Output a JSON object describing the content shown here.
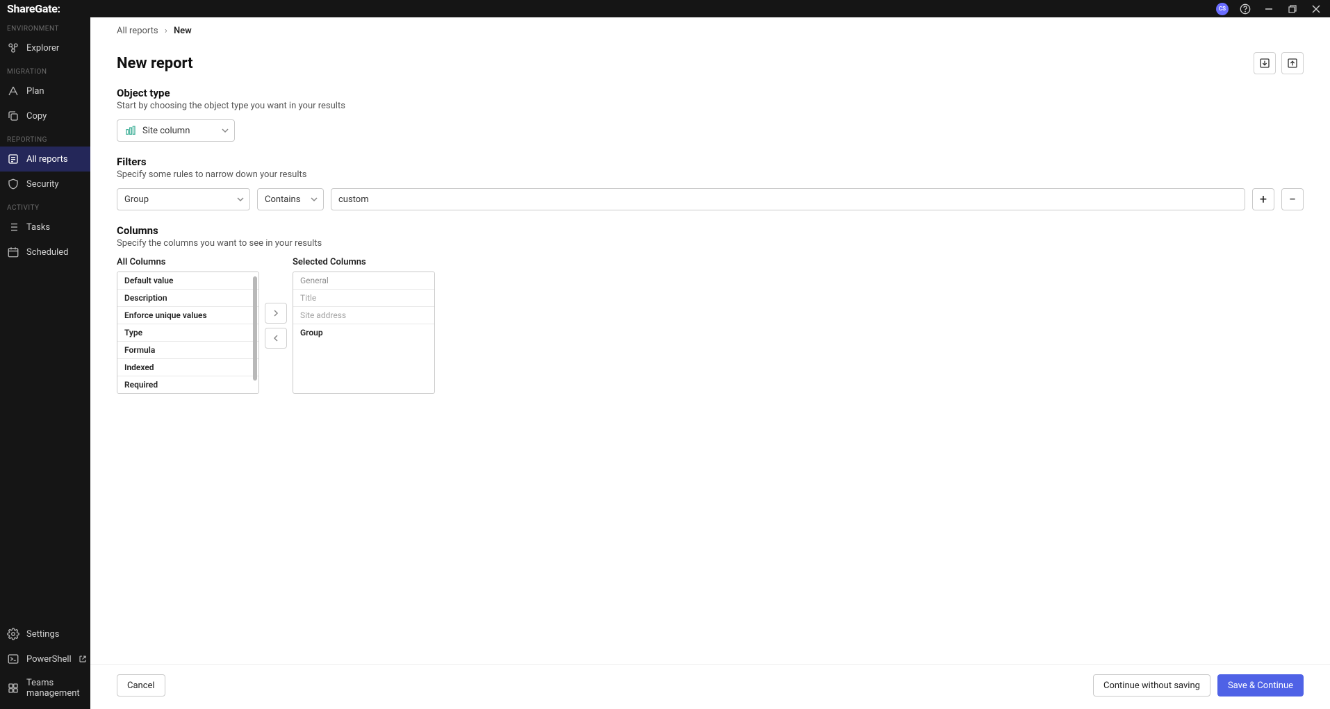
{
  "brand": "ShareGate:",
  "avatar_initials": "CS",
  "sidebar": {
    "sections": [
      {
        "label": "ENVIRONMENT",
        "items": [
          {
            "label": "Explorer",
            "icon": "explorer"
          }
        ]
      },
      {
        "label": "MIGRATION",
        "items": [
          {
            "label": "Plan",
            "icon": "plan"
          },
          {
            "label": "Copy",
            "icon": "copy"
          }
        ]
      },
      {
        "label": "REPORTING",
        "items": [
          {
            "label": "All reports",
            "icon": "reports",
            "active": true
          },
          {
            "label": "Security",
            "icon": "security"
          }
        ]
      },
      {
        "label": "ACTIVITY",
        "items": [
          {
            "label": "Tasks",
            "icon": "tasks"
          },
          {
            "label": "Scheduled",
            "icon": "scheduled"
          }
        ]
      }
    ],
    "bottom": [
      {
        "label": "Settings",
        "icon": "settings"
      },
      {
        "label": "PowerShell",
        "icon": "powershell",
        "external": true
      },
      {
        "label": "Teams management",
        "icon": "teams"
      }
    ]
  },
  "breadcrumb": {
    "root": "All reports",
    "current": "New"
  },
  "page": {
    "title": "New report"
  },
  "object_type": {
    "title": "Object type",
    "desc": "Start by choosing the object type you want in your results",
    "selected": "Site column"
  },
  "filters": {
    "title": "Filters",
    "desc": "Specify some rules to narrow down your results",
    "rows": [
      {
        "field": "Group",
        "operator": "Contains",
        "value": "custom"
      }
    ]
  },
  "columns": {
    "title": "Columns",
    "desc": "Specify the columns you want to see in your results",
    "all_label": "All Columns",
    "selected_label": "Selected Columns",
    "all": [
      "Default value",
      "Description",
      "Enforce unique values",
      "Type",
      "Formula",
      "Indexed",
      "Required"
    ],
    "selected": [
      {
        "label": "General",
        "category": true
      },
      {
        "label": "Title",
        "muted": true
      },
      {
        "label": "Site address",
        "muted": true
      },
      {
        "label": "Group"
      }
    ]
  },
  "footer": {
    "cancel": "Cancel",
    "continue": "Continue without saving",
    "save": "Save & Continue"
  }
}
